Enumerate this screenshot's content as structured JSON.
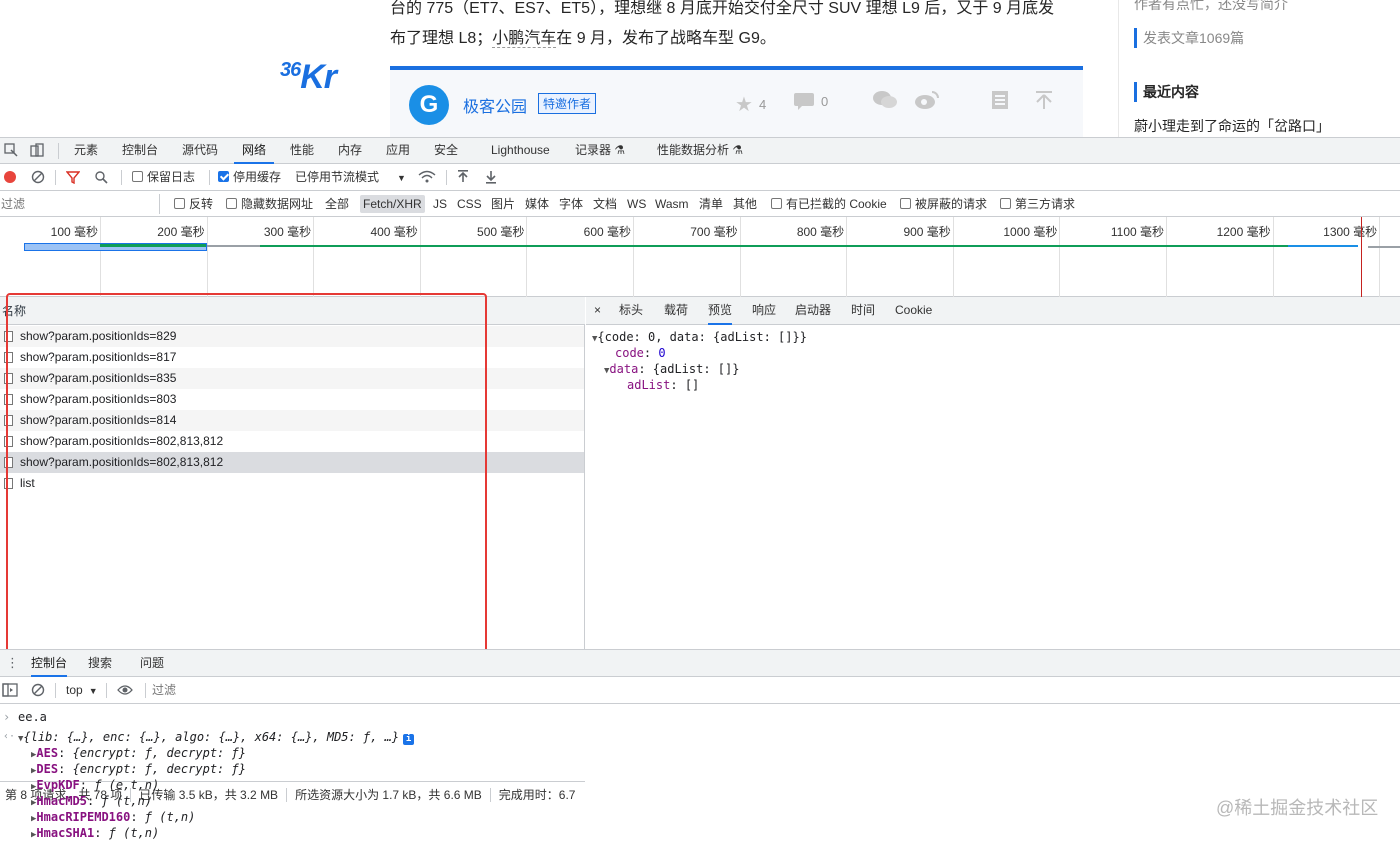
{
  "webpage": {
    "logo": "36Kr",
    "logo_sup": "36",
    "logo_main": "Kr",
    "article_line1": "台的 775（ET7、ES7、ET5），理想继 8 月底开始交付全尺寸 SUV 理想 L9 后，又于 9 月底发",
    "article_line2_pre": "布了理想 L8；",
    "article_line2_link": "小鹏汽车",
    "article_line2_post": "在 9 月，发布了战略车型 G9。",
    "author_avatar": "G",
    "author_name": "极客公园",
    "author_badge": "特邀作者",
    "likes": "4",
    "comments": "0",
    "sidebar_top": "作者有点忙，还没写简介",
    "sidebar_articles": "发表文章1069篇",
    "sidebar_recent_title": "最近内容",
    "sidebar_recent_first": "蔚小理走到了命运的「岔路口」"
  },
  "devtools": {
    "tabs": [
      "元素",
      "控制台",
      "源代码",
      "网络",
      "性能",
      "内存",
      "应用",
      "安全",
      "Lighthouse",
      "记录器 ⚗",
      "性能数据分析 ⚗"
    ],
    "active_tab": "网络",
    "toolbar": {
      "preserve_log": "保留日志",
      "disable_cache": "停用缓存",
      "throttle": "已停用节流模式"
    },
    "filter": {
      "placeholder": "过滤",
      "invert": "反转",
      "hide_data_urls": "隐藏数据网址",
      "types": [
        "全部",
        "Fetch/XHR",
        "JS",
        "CSS",
        "图片",
        "媒体",
        "字体",
        "文档",
        "WS",
        "Wasm",
        "清单",
        "其他"
      ],
      "active_type": "Fetch/XHR",
      "blocked_cookies": "有已拦截的 Cookie",
      "blocked_requests": "被屏蔽的请求",
      "third_party": "第三方请求"
    },
    "timeline_ticks": [
      "100 毫秒",
      "200 毫秒",
      "300 毫秒",
      "400 毫秒",
      "500 毫秒",
      "600 毫秒",
      "700 毫秒",
      "800 毫秒",
      "900 毫秒",
      "1000 毫秒",
      "1100 毫秒",
      "1200 毫秒",
      "1300 毫秒"
    ],
    "request_list": {
      "column_name": "名称",
      "rows": [
        "show?param.positionIds=829",
        "show?param.positionIds=817",
        "show?param.positionIds=835",
        "show?param.positionIds=803",
        "show?param.positionIds=814",
        "show?param.positionIds=802,813,812",
        "show?param.positionIds=802,813,812",
        "list"
      ],
      "selected_index": 6
    },
    "status": {
      "requests": "第 8 项请求，共 78 项",
      "transferred": "已传输 3.5 kB，共 3.2 MB",
      "resources": "所选资源大小为 1.7 kB，共 6.6 MB",
      "finish": "完成用时：6.7"
    },
    "detail_tabs": [
      "×",
      "标头",
      "载荷",
      "预览",
      "响应",
      "启动器",
      "时间",
      "Cookie"
    ],
    "detail_active": "预览",
    "preview": {
      "root": "{code: 0, data: {adList: []}}",
      "code_key": "code",
      "code_val": "0",
      "data_key": "data",
      "data_val": "{adList: []}",
      "adlist_key": "adList",
      "adlist_val": "[]"
    },
    "drawer_tabs": [
      "控制台",
      "搜索",
      "问题"
    ],
    "drawer_active": "控制台",
    "console_context": "top",
    "console_filter_placeholder": "过滤",
    "console": {
      "input": "ee.a",
      "output_root": "{lib: {…}, enc: {…}, algo: {…}, x64: {…}, MD5: ƒ, …}",
      "props": [
        {
          "key": "AES",
          "val": "{encrypt: ƒ, decrypt: ƒ}"
        },
        {
          "key": "DES",
          "val": "{encrypt: ƒ, decrypt: ƒ}"
        },
        {
          "key": "EvpKDF",
          "val": "ƒ (e,t,n)"
        },
        {
          "key": "HmacMD5",
          "val": "ƒ (t,n)"
        },
        {
          "key": "HmacRIPEMD160",
          "val": "ƒ (t,n)"
        },
        {
          "key": "HmacSHA1",
          "val": "ƒ (t,n)"
        }
      ]
    }
  },
  "watermark": "@稀土掘金技术社区"
}
